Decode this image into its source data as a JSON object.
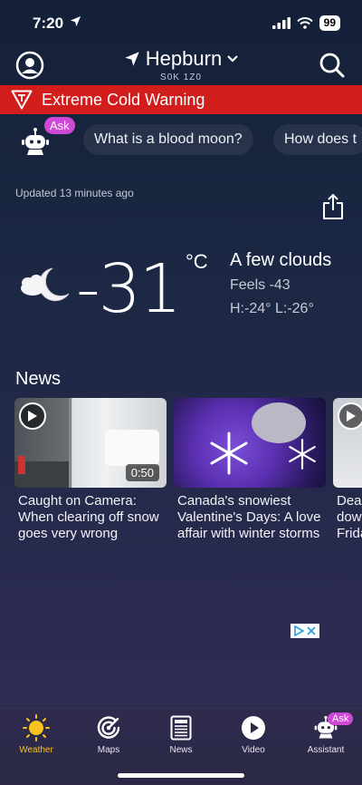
{
  "status": {
    "time": "7:20",
    "battery": "99"
  },
  "header": {
    "location": "Hepburn",
    "postal": "S0K 1Z0"
  },
  "warning": {
    "text": "Extreme Cold Warning"
  },
  "assistant": {
    "ask_label": "Ask",
    "suggestions": [
      "What is a blood moon?",
      "How does t"
    ]
  },
  "updated": "Updated 13 minutes ago",
  "current": {
    "temperature": "-31",
    "unit": "°C",
    "condition": "A few clouds",
    "feels_like": "Feels -43",
    "high_low": "H:-24° L:-26°"
  },
  "news": {
    "title": "News",
    "cards": [
      {
        "headline": "Caught on Camera: When clearing off snow goes very wrong",
        "duration": "0:50"
      },
      {
        "headline": "Canada's snowiest Valentine's Days: A love affair with winter storms"
      },
      {
        "headline": "Dea dow Frida"
      }
    ]
  },
  "tabs": [
    {
      "label": "Weather",
      "icon": "sun-icon",
      "active": true
    },
    {
      "label": "Maps",
      "icon": "radar-icon"
    },
    {
      "label": "News",
      "icon": "newspaper-icon"
    },
    {
      "label": "Video",
      "icon": "play-icon"
    },
    {
      "label": "Assistant",
      "icon": "robot-icon",
      "badge": "Ask"
    }
  ],
  "colors": {
    "warning": "#d21d1d",
    "accent": "#f7c21b",
    "ask_badge": "#d048d6"
  }
}
